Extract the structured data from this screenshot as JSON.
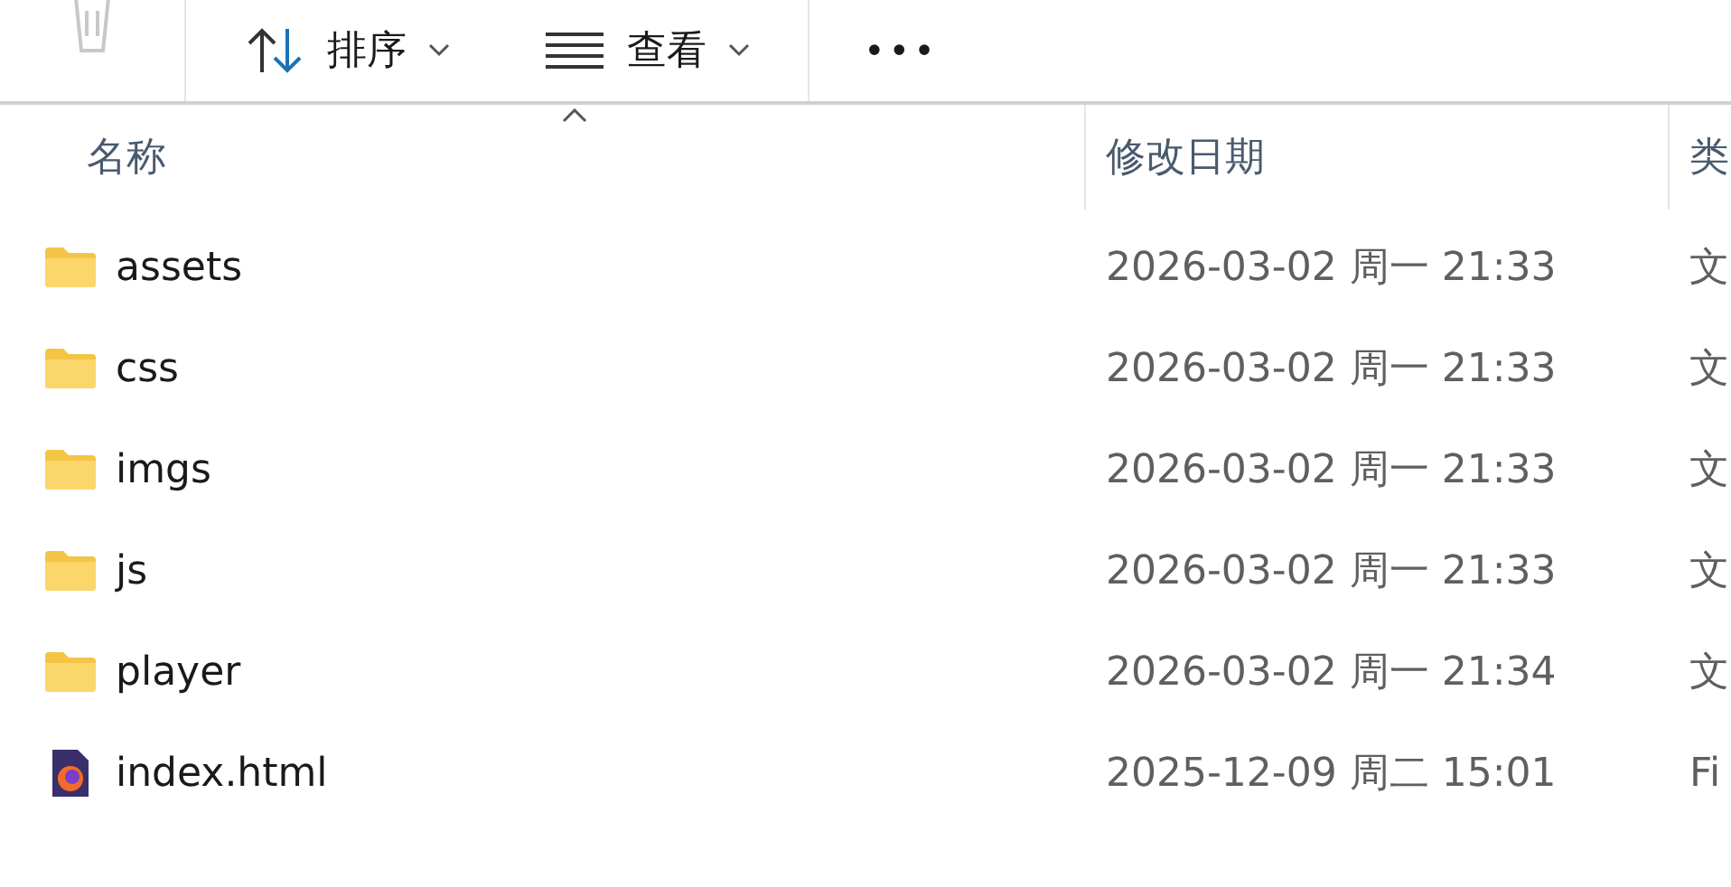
{
  "toolbar": {
    "sort_label": "排序",
    "view_label": "查看",
    "more": "•••"
  },
  "columns": [
    {
      "label": "名称"
    },
    {
      "label": "修改日期"
    },
    {
      "label": "类"
    }
  ],
  "rows": [
    {
      "kind": "folder",
      "name": "assets",
      "modified": "2026-03-02 周一 21:33",
      "type": "文"
    },
    {
      "kind": "folder",
      "name": "css",
      "modified": "2026-03-02 周一 21:33",
      "type": "文"
    },
    {
      "kind": "folder",
      "name": "imgs",
      "modified": "2026-03-02 周一 21:33",
      "type": "文"
    },
    {
      "kind": "folder",
      "name": "js",
      "modified": "2026-03-02 周一 21:33",
      "type": "文"
    },
    {
      "kind": "folder",
      "name": "player",
      "modified": "2026-03-02 周一 21:34",
      "type": "文"
    },
    {
      "kind": "file",
      "name": "index.html",
      "modified": "2025-12-09 周二 15:01",
      "type": "Fi"
    }
  ]
}
